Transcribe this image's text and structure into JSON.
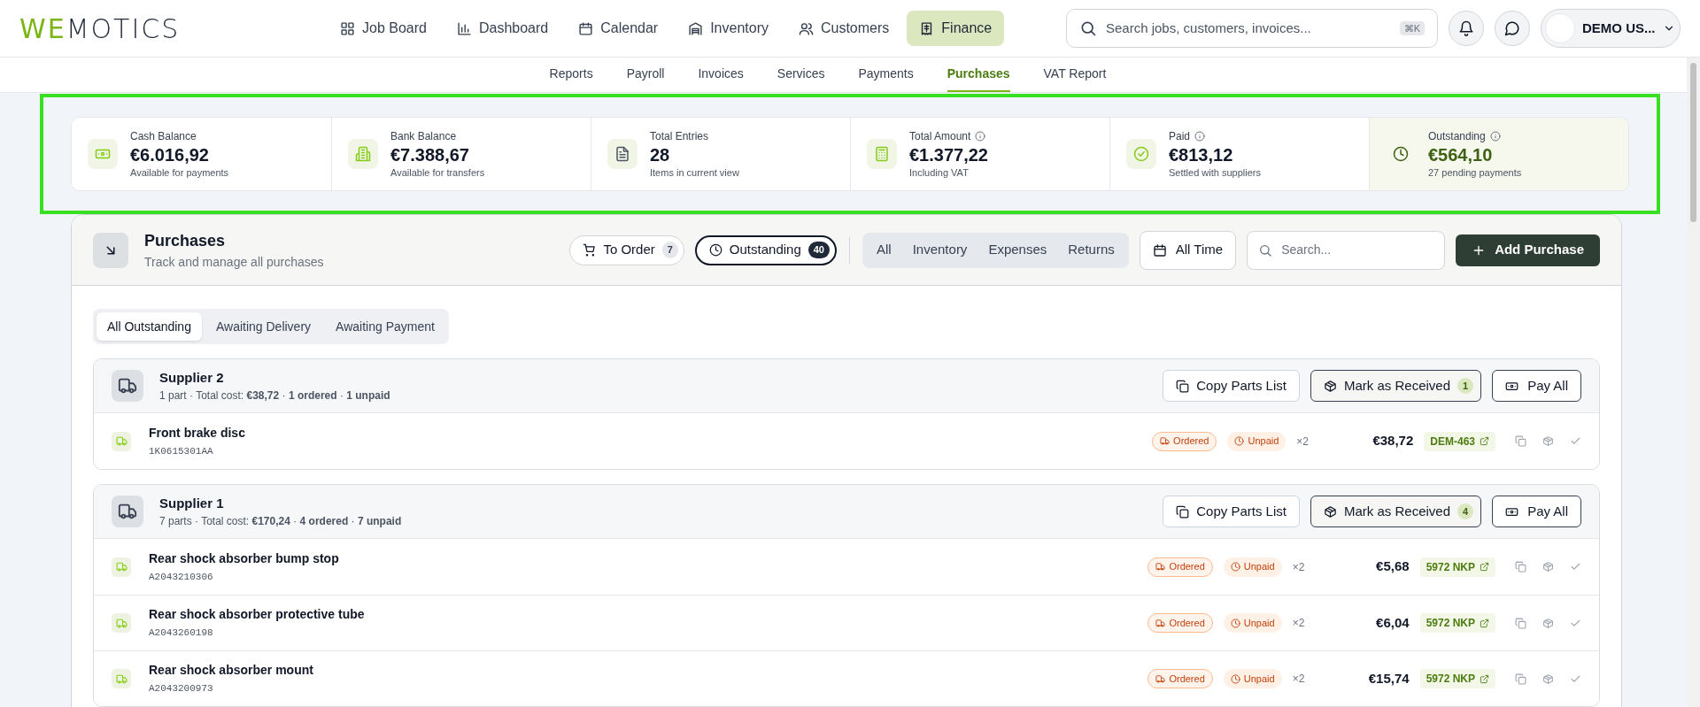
{
  "brand": "WEMOTICS",
  "nav": [
    {
      "label": "Job Board",
      "selected": false
    },
    {
      "label": "Dashboard",
      "selected": false
    },
    {
      "label": "Calendar",
      "selected": false
    },
    {
      "label": "Inventory",
      "selected": false
    },
    {
      "label": "Customers",
      "selected": false
    },
    {
      "label": "Finance",
      "selected": true
    }
  ],
  "search": {
    "placeholder": "Search jobs, customers, invoices...",
    "shortcut": "⌘K"
  },
  "user": {
    "name": "DEMO US..."
  },
  "subnav": [
    {
      "label": "Reports",
      "selected": false
    },
    {
      "label": "Payroll",
      "selected": false
    },
    {
      "label": "Invoices",
      "selected": false
    },
    {
      "label": "Services",
      "selected": false
    },
    {
      "label": "Payments",
      "selected": false
    },
    {
      "label": "Purchases",
      "selected": true
    },
    {
      "label": "VAT Report",
      "selected": false
    }
  ],
  "stats": [
    {
      "label": "Cash Balance",
      "value": "€6.016,92",
      "sub": "Available for payments",
      "info": false,
      "highlighted": false
    },
    {
      "label": "Bank Balance",
      "value": "€7.388,67",
      "sub": "Available for transfers",
      "info": false,
      "highlighted": false
    },
    {
      "label": "Total Entries",
      "value": "28",
      "sub": "Items in current view",
      "info": false,
      "highlighted": false
    },
    {
      "label": "Total Amount",
      "value": "€1.377,22",
      "sub": "Including VAT",
      "info": true,
      "highlighted": false
    },
    {
      "label": "Paid",
      "value": "€813,12",
      "sub": "Settled with suppliers",
      "info": true,
      "highlighted": false
    },
    {
      "label": "Outstanding",
      "value": "€564,10",
      "sub": "27 pending payments",
      "info": true,
      "highlighted": true
    }
  ],
  "purchases": {
    "title": "Purchases",
    "subtitle": "Track and manage all purchases",
    "filters": [
      {
        "label": "To Order",
        "count": "7",
        "selected": false
      },
      {
        "label": "Outstanding",
        "count": "40",
        "selected": true
      }
    ],
    "types": [
      "All",
      "Inventory",
      "Expenses",
      "Returns"
    ],
    "date": "All Time",
    "search_placeholder": "Search...",
    "add_button": "Add Purchase"
  },
  "status_tabs": [
    {
      "label": "All Outstanding",
      "selected": true
    },
    {
      "label": "Awaiting Delivery",
      "selected": false
    },
    {
      "label": "Awaiting Payment",
      "selected": false
    }
  ],
  "groups": [
    {
      "supplier": "Supplier 2",
      "summary": "1 part · Total cost: **€38,72** · **1 ordered** · **1 unpaid**",
      "copy": "Copy Parts List",
      "receive": "Mark as Received",
      "receive_count": "1",
      "pay": "Pay All",
      "items": [
        {
          "name": "Front brake disc",
          "part_no": "1K0615301AA",
          "status": "Ordered",
          "payment": "Unpaid",
          "qty": "×2",
          "price": "€38,72",
          "ref": "DEM-463"
        }
      ]
    },
    {
      "supplier": "Supplier 1",
      "summary": "7 parts · Total cost: **€170,24** · **4 ordered** · **7 unpaid**",
      "copy": "Copy Parts List",
      "receive": "Mark as Received",
      "receive_count": "4",
      "pay": "Pay All",
      "items": [
        {
          "name": "Rear shock absorber bump stop",
          "part_no": "A2043210306",
          "status": "Ordered",
          "payment": "Unpaid",
          "qty": "×2",
          "price": "€5,68",
          "ref": "5972 NKP"
        },
        {
          "name": "Rear shock absorber protective tube",
          "part_no": "A2043260198",
          "status": "Ordered",
          "payment": "Unpaid",
          "qty": "×2",
          "price": "€6,04",
          "ref": "5972 NKP"
        },
        {
          "name": "Rear shock absorber mount",
          "part_no": "A2043200973",
          "status": "Ordered",
          "payment": "Unpaid",
          "qty": "×2",
          "price": "€15,74",
          "ref": "5972 NKP"
        }
      ]
    }
  ]
}
